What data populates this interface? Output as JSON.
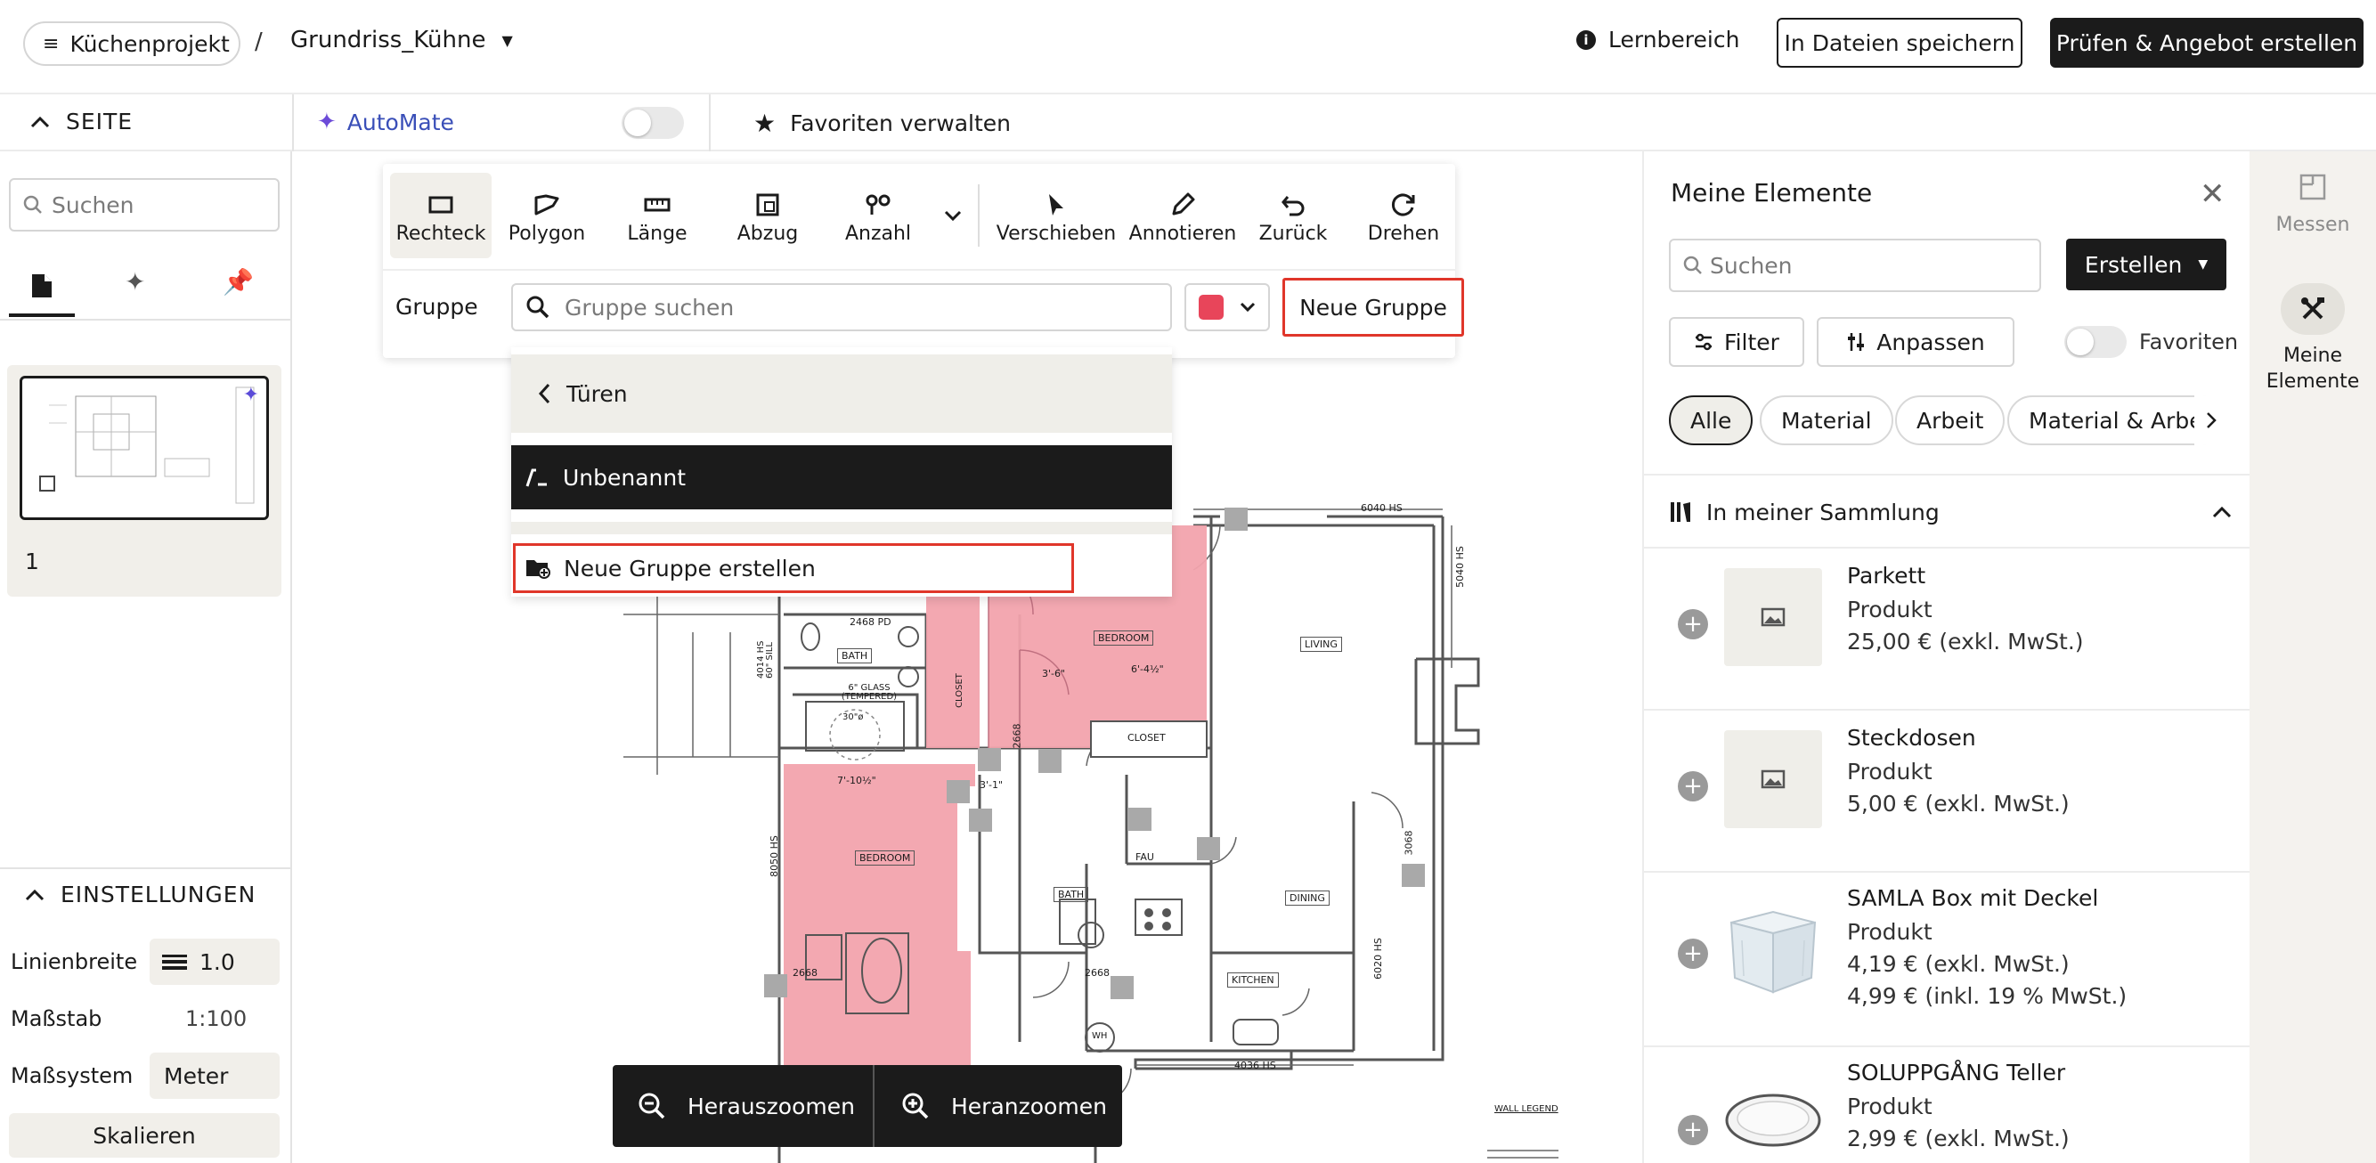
{
  "header": {
    "project_label": "Küchenprojekt",
    "separator": "/",
    "file_name": "Grundriss_Kühne",
    "learn_label": "Lernbereich",
    "save_label": "In Dateien speichern",
    "offer_label": "Prüfen & Angebot erstellen"
  },
  "secondbar": {
    "page_label": "SEITE",
    "automate_label": "AutoMate",
    "favorites_label": "Favoriten verwalten"
  },
  "left": {
    "search_placeholder": "Suchen",
    "page_number": "1",
    "settings_title": "EINSTELLUNGEN",
    "line_width_label": "Linienbreite",
    "line_width_value": "1.0",
    "scale_label": "Maßstab",
    "scale_value": "1:100",
    "measure_system_label": "Maßsystem",
    "measure_system_value": "Meter",
    "scale_button": "Skalieren"
  },
  "toolbar": {
    "tools": [
      "Rechteck",
      "Polygon",
      "Länge",
      "Abzug",
      "Anzahl",
      "Verschieben",
      "Annotieren",
      "Zurück",
      "Drehen"
    ],
    "group_label": "Gruppe",
    "group_search_placeholder": "Gruppe suchen",
    "group_color": "#e8455a",
    "new_group_button": "Neue Gruppe"
  },
  "dropdown": {
    "back_label": "Türen",
    "selected_item": "Unbenannt",
    "create_label": "Neue Gruppe erstellen"
  },
  "zoom": {
    "zoom_out": "Herauszoomen",
    "zoom_in": "Heranzoomen"
  },
  "plan": {
    "room_labels": [
      "BEDROOM",
      "BEDROOM",
      "LIVING",
      "CLOSET",
      "CLOSET",
      "BATH",
      "BATH",
      "FAU",
      "DINING",
      "KITCHEN",
      "WH"
    ],
    "dim_labels": [
      "6040 HS",
      "5040 HS",
      "8050 HS",
      "3068",
      "6020 HS",
      "4036 HS",
      "2468 PD",
      "2668",
      "2668",
      "2668",
      "7'-10½\"",
      "3'-6\"",
      "6'-4½\"",
      "3'-1\"",
      "6\" GLASS (TEMPERED)",
      "30\"ø",
      "4014 HS 60\" SILL"
    ],
    "legend_label": "WALL LEGEND",
    "highlight_color": "#f2a3ad"
  },
  "right": {
    "title": "Meine Elemente",
    "search_placeholder": "Suchen",
    "create_label": "Erstellen",
    "filter_label": "Filter",
    "customize_label": "Anpassen",
    "favorites_label": "Favoriten",
    "chips": [
      "Alle",
      "Material",
      "Arbeit",
      "Material & Arbe"
    ],
    "collection_title": "In meiner Sammlung",
    "products": [
      {
        "name": "Parkett",
        "type": "Produkt",
        "price": "25,00 € (exkl. MwSt.)",
        "price2": "",
        "image": "placeholder"
      },
      {
        "name": "Steckdosen",
        "type": "Produkt",
        "price": "5,00 € (exkl. MwSt.)",
        "price2": "",
        "image": "placeholder"
      },
      {
        "name": "SAMLA Box mit Deckel",
        "type": "Produkt",
        "price": "4,19 € (exkl. MwSt.)",
        "price2": "4,99 € (inkl. 19 % MwSt.)",
        "image": "box"
      },
      {
        "name": "SOLUPPGÅNG Teller",
        "type": "Produkt",
        "price": "2,99 € (exkl. MwSt.)",
        "price2": "",
        "image": "plate"
      }
    ]
  },
  "farright": {
    "measure_label": "Messen",
    "my_elements_label": "Meine Elemente"
  }
}
